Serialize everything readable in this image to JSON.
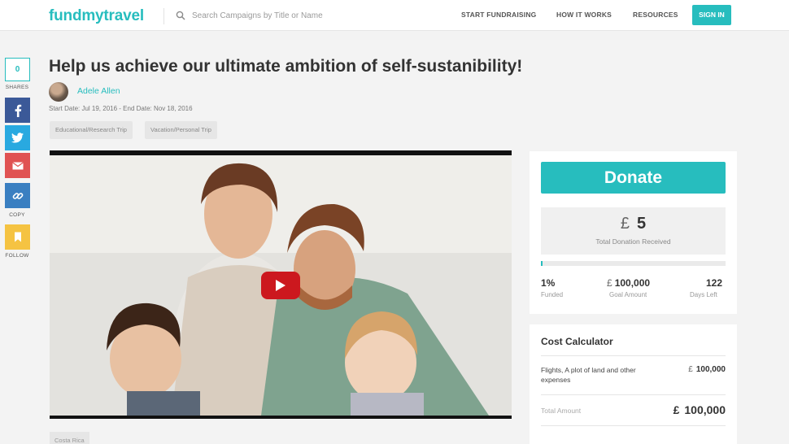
{
  "header": {
    "logo": "fundmytravel",
    "search_placeholder": "Search Campaigns by Title or Name",
    "nav": [
      "START FUNDRAISING",
      "HOW IT WORKS",
      "RESOURCES"
    ],
    "signin": "SIGN IN",
    "accent_color": "#27bdbe"
  },
  "share": {
    "count": "0",
    "shares_label": "SHARES",
    "copy_label": "COPY",
    "follow_label": "FOLLOW",
    "buttons": [
      {
        "icon": "facebook-icon",
        "color": "#3b5998"
      },
      {
        "icon": "twitter-icon",
        "color": "#29a9e0"
      },
      {
        "icon": "email-icon",
        "color": "#e05252"
      },
      {
        "icon": "link-icon",
        "color": "#3a7fc1"
      },
      {
        "icon": "bookmark-icon",
        "color": "#f5c342"
      }
    ]
  },
  "campaign": {
    "title": "Help us achieve our ultimate ambition of self-sustanibility!",
    "author": "Adele Allen",
    "dates": "Start Date: Jul 19, 2016 - End Date: Nov 18, 2016",
    "tags": [
      "Educational/Research Trip",
      "Vacation/Personal Trip"
    ],
    "bottom_tag": "Costa Rica"
  },
  "donation": {
    "donate_label": "Donate",
    "currency": "£",
    "total": "5",
    "total_label": "Total Donation Received",
    "progress_percent": 1,
    "funded_value": "1%",
    "funded_label": "Funded",
    "goal_value": "100,000",
    "goal_label": "Goal Amount",
    "days_value": "122",
    "days_label": "Days Left"
  },
  "calculator": {
    "title": "Cost Calculator",
    "item_label": "Flights, A plot of land and other expenses",
    "item_amount": "100,000",
    "total_label": "Total Amount",
    "total_amount": "100,000"
  }
}
